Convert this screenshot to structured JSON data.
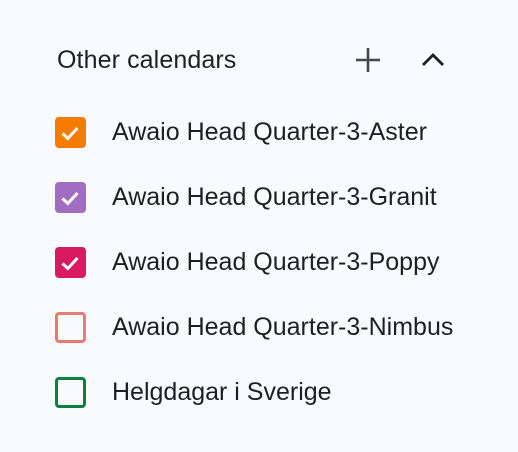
{
  "header": {
    "title": "Other calendars"
  },
  "calendars": [
    {
      "label": "Awaio Head Quarter-3-Aster",
      "checked": true,
      "color": "#f57c00"
    },
    {
      "label": "Awaio Head Quarter-3-Granit",
      "checked": true,
      "color": "#a06dc2"
    },
    {
      "label": "Awaio Head Quarter-3-Poppy",
      "checked": true,
      "color": "#d81b60"
    },
    {
      "label": "Awaio Head Quarter-3-Nimbus",
      "checked": false,
      "color": "#e67c73"
    },
    {
      "label": "Helgdagar i Sverige",
      "checked": false,
      "color": "#0b8043"
    }
  ],
  "icons": {
    "add": "plus-icon",
    "collapse": "chevron-up-icon",
    "check": "checkmark-icon"
  }
}
